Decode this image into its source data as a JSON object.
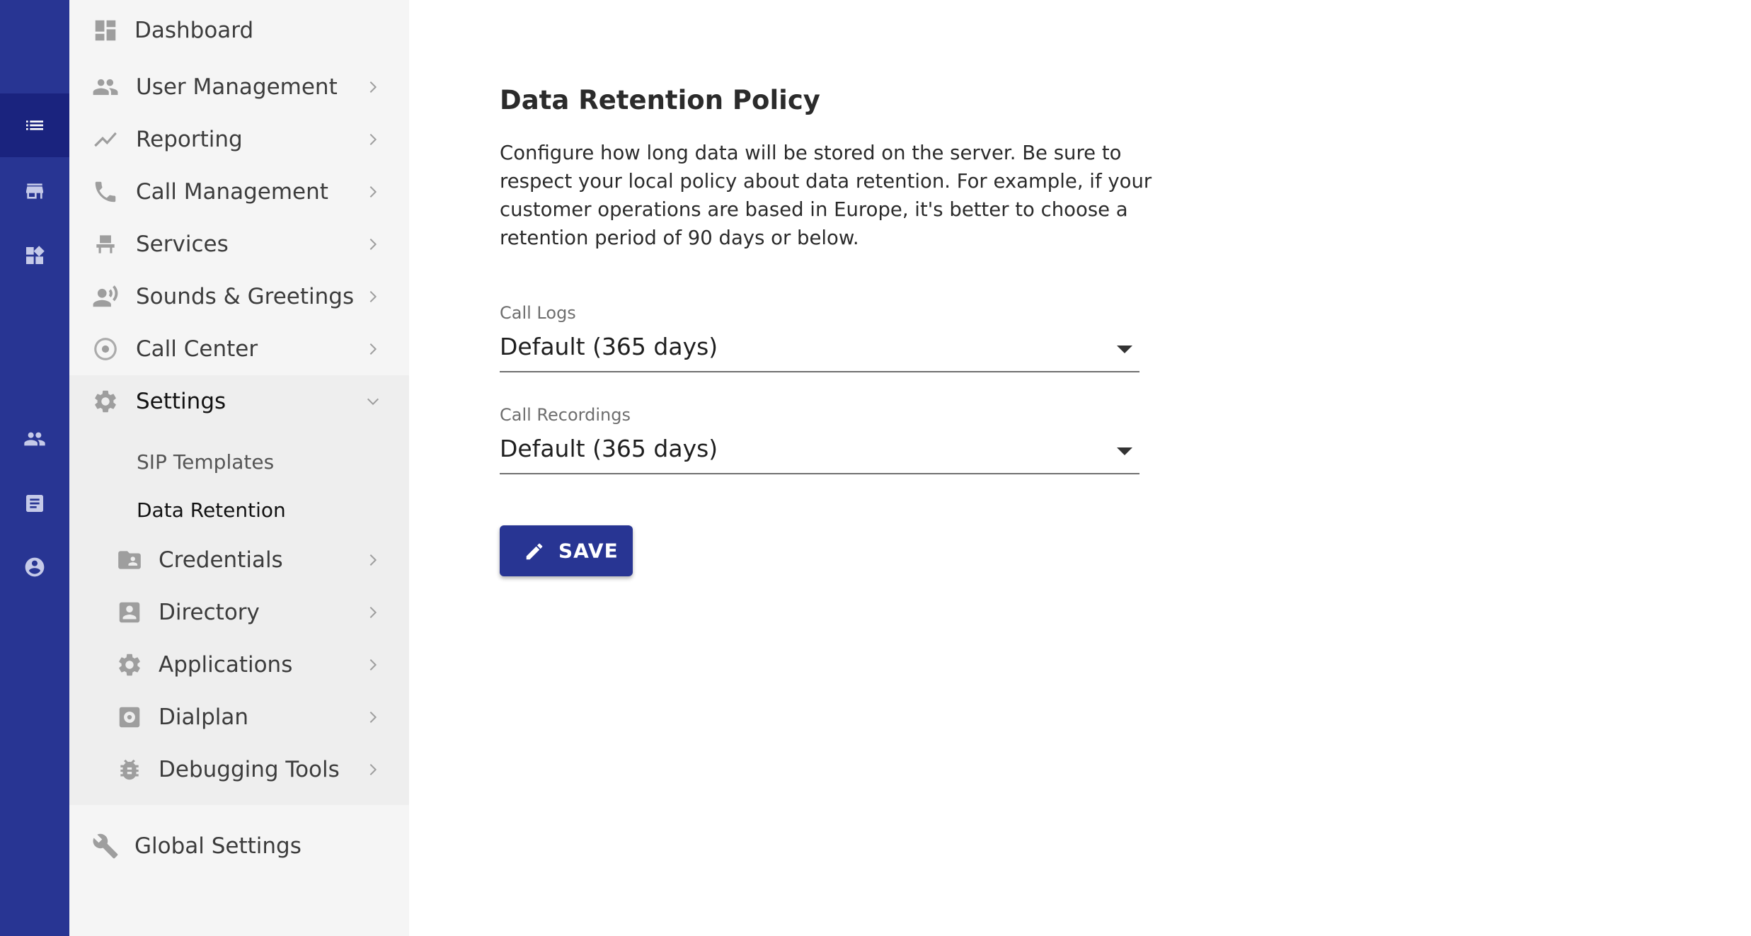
{
  "sidebar": {
    "items": [
      {
        "label": "Dashboard",
        "icon": "dashboard-icon"
      },
      {
        "label": "User Management",
        "icon": "people-icon"
      },
      {
        "label": "Reporting",
        "icon": "trending-line-icon"
      },
      {
        "label": "Call Management",
        "icon": "phone-icon"
      },
      {
        "label": "Services",
        "icon": "service-chair-icon"
      },
      {
        "label": "Sounds & Greetings",
        "icon": "speaking-person-icon"
      },
      {
        "label": "Call Center",
        "icon": "target-circle-icon"
      },
      {
        "label": "Settings",
        "icon": "gear-icon"
      }
    ],
    "settings_sub": [
      {
        "label": "SIP Templates"
      },
      {
        "label": "Data Retention"
      }
    ],
    "settings_groups": [
      {
        "label": "Credentials",
        "icon": "contact-folder-icon"
      },
      {
        "label": "Directory",
        "icon": "contact-card-icon"
      },
      {
        "label": "Applications",
        "icon": "gear-icon"
      },
      {
        "label": "Dialplan",
        "icon": "dialplan-icon"
      },
      {
        "label": "Debugging Tools",
        "icon": "bug-icon"
      }
    ],
    "global": {
      "label": "Global Settings",
      "icon": "wrench-icon"
    }
  },
  "main": {
    "title": "Data Retention Policy",
    "description": "Configure how long data will be stored on the server. Be sure to respect your local policy about data retention. For example, if your customer operations are based in Europe, it's better to choose a retention period of 90 days or below.",
    "fields": [
      {
        "label": "Call Logs",
        "value": "Default (365 days)"
      },
      {
        "label": "Call Recordings",
        "value": "Default (365 days)"
      }
    ],
    "save_label": "SAVE"
  },
  "colors": {
    "rail": "#283593",
    "rail_active": "#1a237e",
    "sidebar_bg": "#f5f5f5",
    "settings_bg": "#eeeeee",
    "primary": "#283593"
  }
}
